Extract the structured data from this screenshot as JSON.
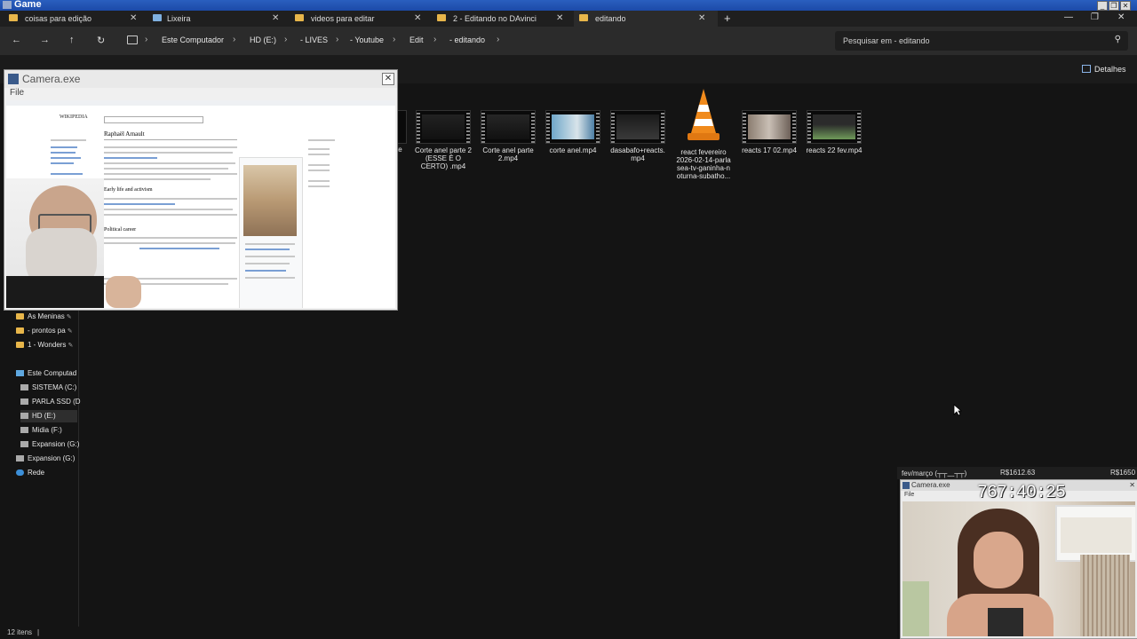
{
  "game": {
    "title": "Game"
  },
  "tabs": [
    {
      "label": "coisas para edição",
      "icon": "folder-icon"
    },
    {
      "label": "Lixeira",
      "icon": "recycle-bin-icon"
    },
    {
      "label": "videos para editar",
      "icon": "folder-icon"
    },
    {
      "label": "2 - Editando no DAvinci",
      "icon": "folder-icon"
    },
    {
      "label": "editando",
      "icon": "folder-icon",
      "active": true
    }
  ],
  "new_tab": "+",
  "breadcrumb": [
    "Este Computador",
    "HD (E:)",
    "- LIVES",
    "- Youtube",
    "Edit",
    "- editando"
  ],
  "search": {
    "placeholder": "Pesquisar em - editando"
  },
  "details_label": "Detalhes",
  "sidebar": {
    "quick": [
      {
        "label": "As Meninas",
        "pinned": true
      },
      {
        "label": "- prontos pa",
        "pinned": true
      },
      {
        "label": "1 - Wonders",
        "pinned": true
      }
    ],
    "computer": [
      {
        "label": "Este Computad"
      },
      {
        "label": "SISTEMA (C:)"
      },
      {
        "label": "PARLA SSD (D"
      },
      {
        "label": "HD (E:)",
        "selected": true
      },
      {
        "label": "Midia (F:)"
      },
      {
        "label": "Expansion (G:)"
      },
      {
        "label": "Expansion (G:)"
      },
      {
        "label": "Rede"
      }
    ]
  },
  "files": [
    {
      "name": "Corte anel parte 2 (ESSE É O CERTO) .mp4"
    },
    {
      "name": "Corte anel parte 2.mp4"
    },
    {
      "name": "corte anel.mp4"
    },
    {
      "name": "dasabafo+reacts.mp4"
    },
    {
      "name": "react fevereiro 2026-02-14-parla sea-tv-ganinha-n oturna-subatho..."
    },
    {
      "name": "reacts 17 02.mp4"
    },
    {
      "name": "reacts 22 fev.mp4"
    }
  ],
  "camera_window": {
    "title": "Camera.exe",
    "menu": "File",
    "wiki": {
      "article_title": "Raphaël Arnault",
      "section_1": "Early life and activism",
      "section_2": "Political career",
      "logo": "WIKIPEDIA"
    }
  },
  "overlay": {
    "left_text": "fev/março (┬┬﹏┬┬)",
    "amount_1": "R$1612.63",
    "amount_2": "R$1650",
    "camera_title": "Camera.exe",
    "menu": "File",
    "timer": "767:40:25"
  },
  "status": {
    "items_count": "12 itens"
  }
}
